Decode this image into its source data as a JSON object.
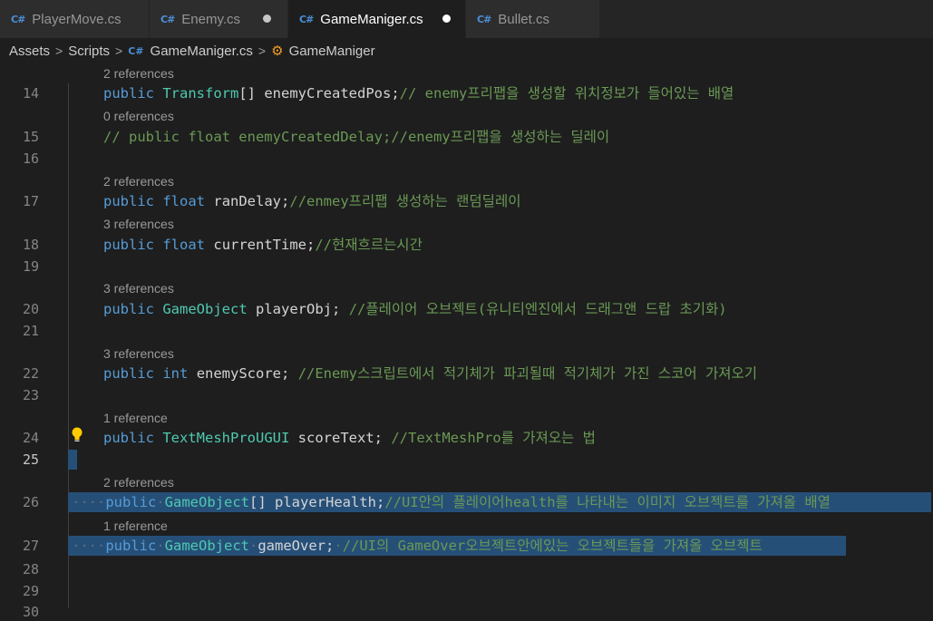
{
  "tabs": [
    {
      "label": "PlayerMove.cs",
      "icon": "csharp-file-icon",
      "active": false,
      "modified": false
    },
    {
      "label": "Enemy.cs",
      "icon": "csharp-file-icon",
      "active": false,
      "modified": true
    },
    {
      "label": "GameManiger.cs",
      "icon": "csharp-file-icon",
      "active": true,
      "modified": true
    },
    {
      "label": "Bullet.cs",
      "icon": "csharp-file-icon",
      "active": false,
      "modified": false
    }
  ],
  "breadcrumb": {
    "items": [
      "Assets",
      "Scripts",
      "GameManiger.cs",
      "GameManiger"
    ]
  },
  "editor": {
    "lines": [
      {
        "n": "14",
        "lens": "2 references"
      },
      {
        "n": "15",
        "lens": "0 references"
      },
      {
        "n": "16"
      },
      {
        "n": "17",
        "lens": "2 references"
      },
      {
        "n": "18",
        "lens": "3 references"
      },
      {
        "n": "19"
      },
      {
        "n": "20",
        "lens": "3 references"
      },
      {
        "n": "21"
      },
      {
        "n": "22",
        "lens": "3 references"
      },
      {
        "n": "23"
      },
      {
        "n": "24",
        "lens": "1 reference"
      },
      {
        "n": "25"
      },
      {
        "n": "26",
        "lens": "2 references"
      },
      {
        "n": "27",
        "lens": "1 reference"
      },
      {
        "n": "28"
      },
      {
        "n": "29"
      },
      {
        "n": "30"
      }
    ],
    "code": {
      "l14": {
        "kw": "public",
        "type": "Transform",
        "rest": "[] enemyCreatedPos;",
        "comment": "// enemy프리팹을 생성할 위치정보가 들어있는 배열"
      },
      "l15": {
        "comment": "// public float enemyCreatedDelay;//enemy프리팹을 생성하는 딜레이"
      },
      "l17": {
        "kw": "public",
        "kw2": "float",
        "rest": "ranDelay;",
        "comment": "//enmey프리팹 생성하는 랜덤딜레이"
      },
      "l18": {
        "kw": "public",
        "kw2": "float",
        "rest": "currentTime;",
        "comment": "//현재흐르는시간"
      },
      "l20": {
        "kw": "public",
        "type": "GameObject",
        "rest": "playerObj;",
        "comment": "//플레이어 오브젝트(유니티엔진에서 드래그앤 드랍 초기화)"
      },
      "l22": {
        "kw": "public",
        "kw2": "int",
        "rest": "enemyScore;",
        "comment": "//Enemy스크립트에서 적기체가 파괴될때 적기체가 가진 스코어 가져오기"
      },
      "l24": {
        "kw": "public",
        "type": "TextMeshProUGUI",
        "rest": "scoreText;",
        "comment": "//TextMeshPro를 가져오는 법"
      },
      "l26": {
        "kw": "public",
        "type": "GameObject",
        "rest": "[] playerHealth;",
        "comment": "//UI안의 플레이어health를 나타내는 이미지 오브젝트를 가져올 배열"
      },
      "l27": {
        "kw": "public",
        "type": "GameObject",
        "rest": "gameOver;",
        "comment": "//UI의 GameOver오브젝트안에있는 오브젝트들을 가져올 오브젝트"
      }
    },
    "lightbulb_icon": "lightbulb-icon"
  },
  "colors": {
    "keyword": "#569cd6",
    "type": "#4ec9b0",
    "comment": "#6a9955",
    "selection": "#264f78"
  }
}
